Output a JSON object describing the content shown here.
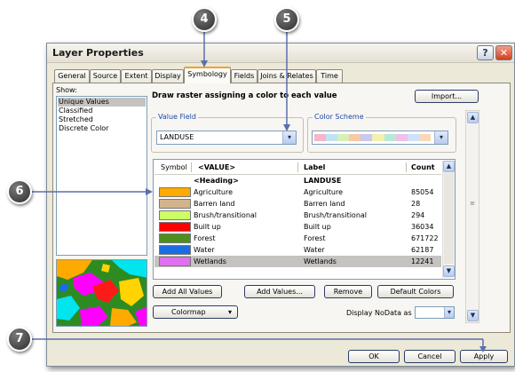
{
  "window": {
    "title": "Layer Properties",
    "help_label": "?",
    "close_label": "✕"
  },
  "tabs": [
    "General",
    "Source",
    "Extent",
    "Display",
    "Symbology",
    "Fields",
    "Joins & Relates",
    "Time"
  ],
  "active_tab": "Symbology",
  "show": {
    "label": "Show:",
    "items": [
      "Unique Values",
      "Classified",
      "Stretched",
      "Discrete Color"
    ],
    "selected": "Unique Values"
  },
  "main": {
    "title": "Draw raster assigning a color to each value",
    "import_label": "Import...",
    "value_field": {
      "label": "Value Field",
      "value": "LANDUSE"
    },
    "color_scheme": {
      "label": "Color Scheme",
      "ramp_colors": [
        "#f4b6c8",
        "#bfe3f4",
        "#d8f0b8",
        "#f8c9a6",
        "#c8c8f0",
        "#f3f0b0",
        "#b8e8d8",
        "#f0c0e8",
        "#d0e0f8",
        "#f8d8b8"
      ]
    }
  },
  "table": {
    "headers": {
      "symbol": "Symbol",
      "value": "<VALUE>",
      "label": "Label",
      "count": "Count"
    },
    "heading_row": {
      "value": "<Heading>",
      "label": "LANDUSE"
    },
    "rows": [
      {
        "color": "#ffaa00",
        "value": "Agriculture",
        "label": "Agriculture",
        "count": "85054",
        "selected": false
      },
      {
        "color": "#d2b48c",
        "value": "Barren land",
        "label": "Barren land",
        "count": "28",
        "selected": false
      },
      {
        "color": "#ccff66",
        "value": "Brush/transitional",
        "label": "Brush/transitional",
        "count": "294",
        "selected": false
      },
      {
        "color": "#ff0000",
        "value": "Built up",
        "label": "Built up",
        "count": "36034",
        "selected": false
      },
      {
        "color": "#4c8f1f",
        "value": "Forest",
        "label": "Forest",
        "count": "671722",
        "selected": false
      },
      {
        "color": "#1a6de0",
        "value": "Water",
        "label": "Water",
        "count": "62187",
        "selected": false
      },
      {
        "color": "#e070f0",
        "value": "Wetlands",
        "label": "Wetlands",
        "count": "12241",
        "selected": true
      }
    ]
  },
  "buttons": {
    "add_all": "Add All Values",
    "add_values": "Add Values...",
    "remove": "Remove",
    "default_colors": "Default Colors",
    "colormap": "Colormap",
    "display_nodata": "Display NoData as",
    "ok": "OK",
    "cancel": "Cancel",
    "apply": "Apply"
  },
  "callouts": [
    "4",
    "5",
    "6",
    "7"
  ]
}
